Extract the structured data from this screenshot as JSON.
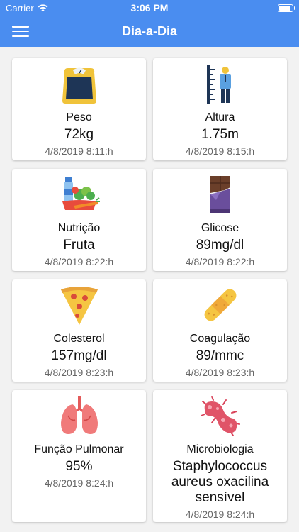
{
  "status": {
    "carrier": "Carrier",
    "time": "3:06 PM",
    "battery_level": 0.95
  },
  "header": {
    "title": "Dia-a-Dia"
  },
  "cards": [
    {
      "label": "Peso",
      "value": "72kg",
      "date": "4/8/2019 8:11:h",
      "icon": "scale-icon"
    },
    {
      "label": "Altura",
      "value": "1.75m",
      "date": "4/8/2019 8:15:h",
      "icon": "height-ruler-icon"
    },
    {
      "label": "Nutrição",
      "value": "Fruta",
      "date": "4/8/2019 8:22:h",
      "icon": "groceries-icon"
    },
    {
      "label": "Glicose",
      "value": "89mg/dl",
      "date": "4/8/2019 8:22:h",
      "icon": "chocolate-bar-icon"
    },
    {
      "label": "Colesterol",
      "value": "157mg/dl",
      "date": "4/8/2019 8:23:h",
      "icon": "pizza-icon"
    },
    {
      "label": "Coagulação",
      "value": "89/mmc",
      "date": "4/8/2019 8:23:h",
      "icon": "bandage-icon"
    },
    {
      "label": "Função Pulmonar",
      "value": "95%",
      "date": "4/8/2019 8:24:h",
      "icon": "lungs-icon"
    },
    {
      "label": "Microbiologia",
      "value": "Staphylococcus aureus oxacilina sensível",
      "date": "4/8/2019 8:24:h",
      "icon": "bacteria-icon"
    }
  ]
}
